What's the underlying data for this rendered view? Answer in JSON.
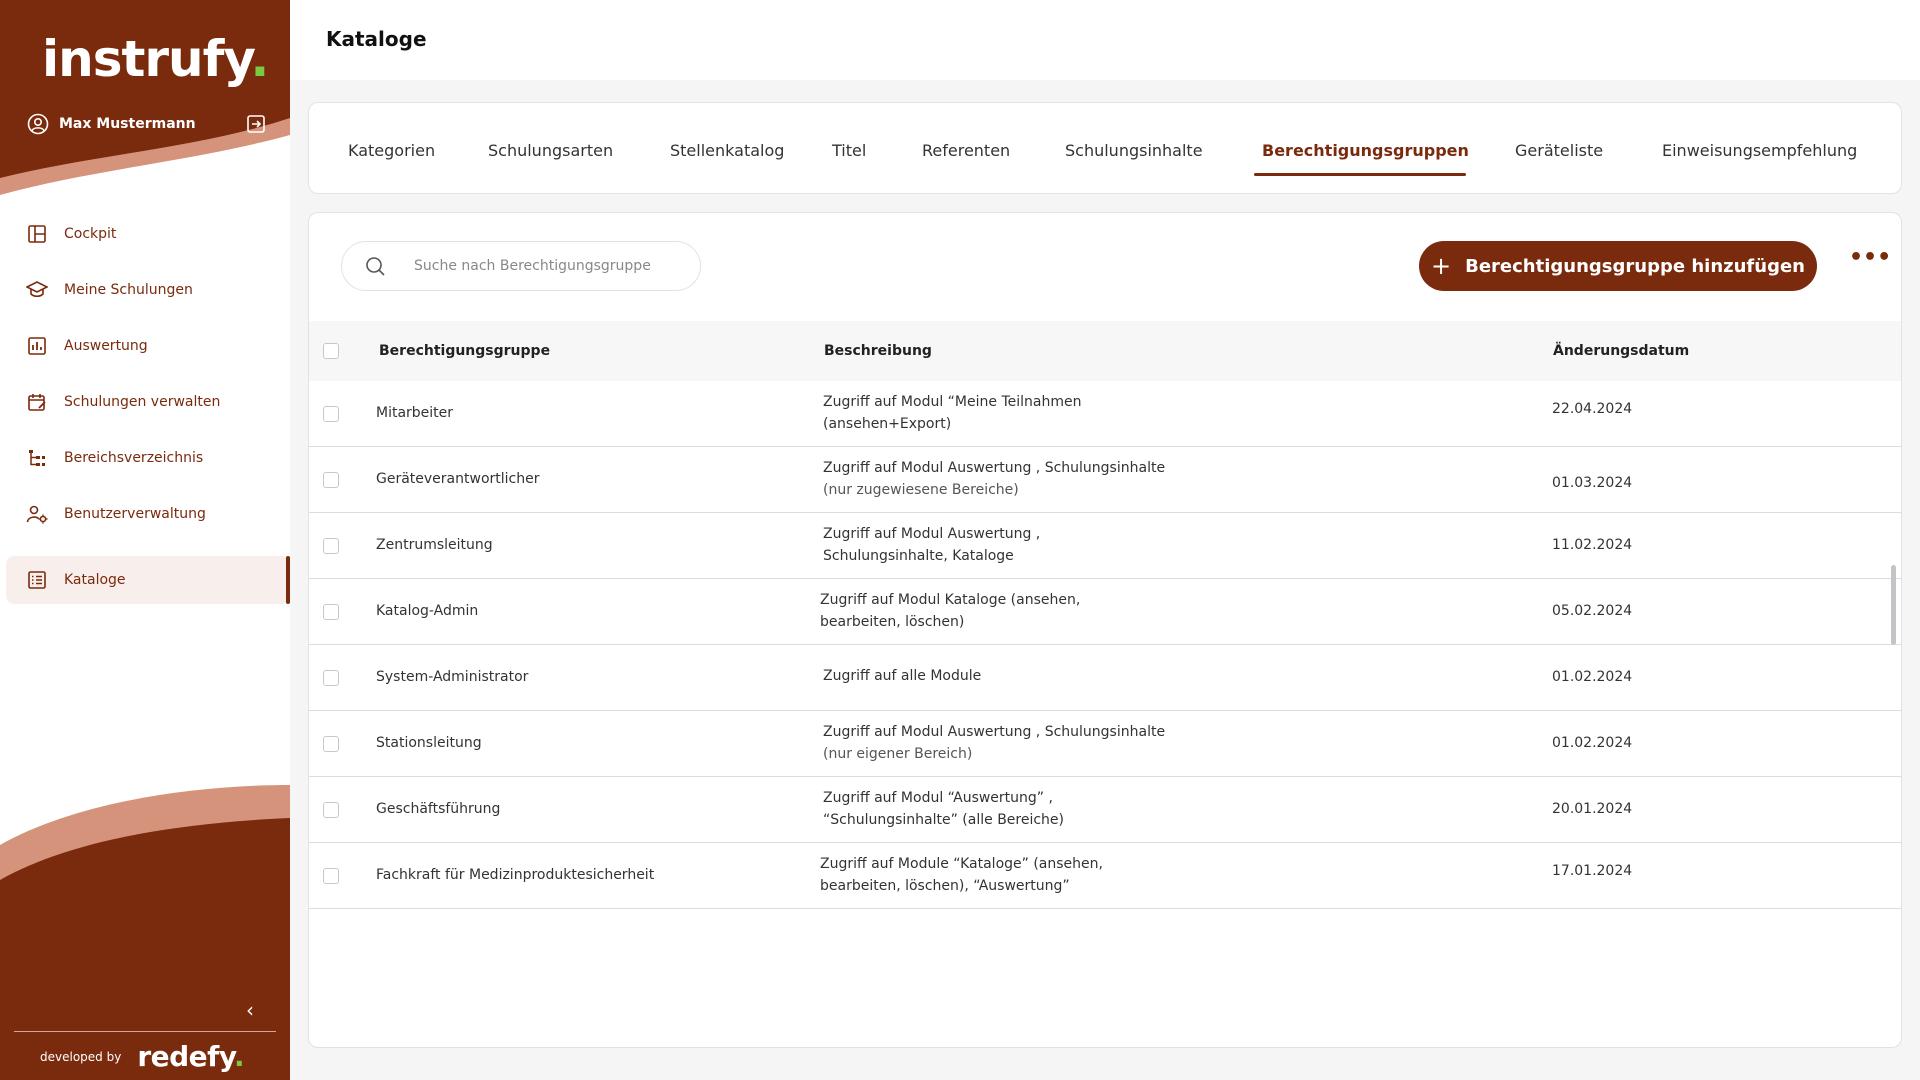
{
  "sidebar": {
    "logo_text": "instrufy",
    "logo_dot": ".",
    "user_name": "Max Mustermann",
    "items": [
      {
        "label": "Cockpit",
        "icon": "dashboard-icon"
      },
      {
        "label": "Meine Schulungen",
        "icon": "graduation-cap-icon"
      },
      {
        "label": "Auswertung",
        "icon": "bar-chart-icon"
      },
      {
        "label": "Schulungen verwalten",
        "icon": "calendar-edit-icon"
      },
      {
        "label": "Bereichsverzeichnis",
        "icon": "tree-icon"
      },
      {
        "label": "Benutzerverwaltung",
        "icon": "user-settings-icon"
      },
      {
        "label": "Kataloge",
        "icon": "list-icon",
        "active": true
      }
    ],
    "developed_by": "developed by",
    "brand": "redefy",
    "brand_dot": ".",
    "colors": {
      "primary": "#7a2a0d",
      "accent_light": "#d4937a",
      "logo_dot": "#7ac943"
    }
  },
  "header": {
    "title": "Kataloge"
  },
  "tabs": [
    {
      "label": "Kategorien"
    },
    {
      "label": "Schulungsarten"
    },
    {
      "label": "Stellenkatalog"
    },
    {
      "label": "Titel"
    },
    {
      "label": "Referenten"
    },
    {
      "label": "Schulungsinhalte"
    },
    {
      "label": "Berechtigungsgruppen",
      "active": true
    },
    {
      "label": "Geräteliste"
    },
    {
      "label": "Einweisungsempfehlung"
    }
  ],
  "toolbar": {
    "search_placeholder": "Suche nach Berechtigungsgruppe",
    "add_label": "Berechtigungsgruppe hinzufügen",
    "more_label": "•••"
  },
  "table": {
    "headers": {
      "group": "Berechtigungsgruppe",
      "description": "Beschreibung",
      "date": "Änderungsdatum"
    },
    "rows": [
      {
        "group": "Mitarbeiter",
        "desc1": "Zugriff auf Modul “Meine Teilnahmen",
        "desc2": "(ansehen+Export)",
        "date": "22.04.2024"
      },
      {
        "group": "Geräteverantwortlicher",
        "desc1": "Zugriff auf Modul Auswertung , Schulungsinhalte",
        "desc2": "(nur zugewiesene Bereiche)",
        "date": "01.03.2024"
      },
      {
        "group": "Zentrumsleitung",
        "desc1": "Zugriff auf Modul Auswertung ,",
        "desc2": "Schulungsinhalte, Kataloge",
        "date": "11.02.2024"
      },
      {
        "group": "Katalog-Admin",
        "desc1": "Zugriff auf Modul Kataloge (ansehen,",
        "desc2": "bearbeiten, löschen)",
        "date": "05.02.2024"
      },
      {
        "group": "System-Administrator",
        "desc1": "Zugriff auf alle Module",
        "desc2": "",
        "date": "01.02.2024"
      },
      {
        "group": "Stationsleitung",
        "desc1": "Zugriff auf Modul Auswertung , Schulungsinhalte",
        "desc2": "(nur eigener Bereich)",
        "date": "01.02.2024"
      },
      {
        "group": "Geschäftsführung",
        "desc1": "Zugriff auf Modul “Auswertung” ,",
        "desc2": "“Schulungsinhalte” (alle Bereiche)",
        "date": "20.01.2024"
      },
      {
        "group": "Fachkraft für Medizinproduktesicherheit",
        "desc1": "Zugriff auf Module “Kataloge” (ansehen,",
        "desc2": "bearbeiten, löschen), “Auswertung”",
        "date": "17.01.2024"
      }
    ]
  }
}
